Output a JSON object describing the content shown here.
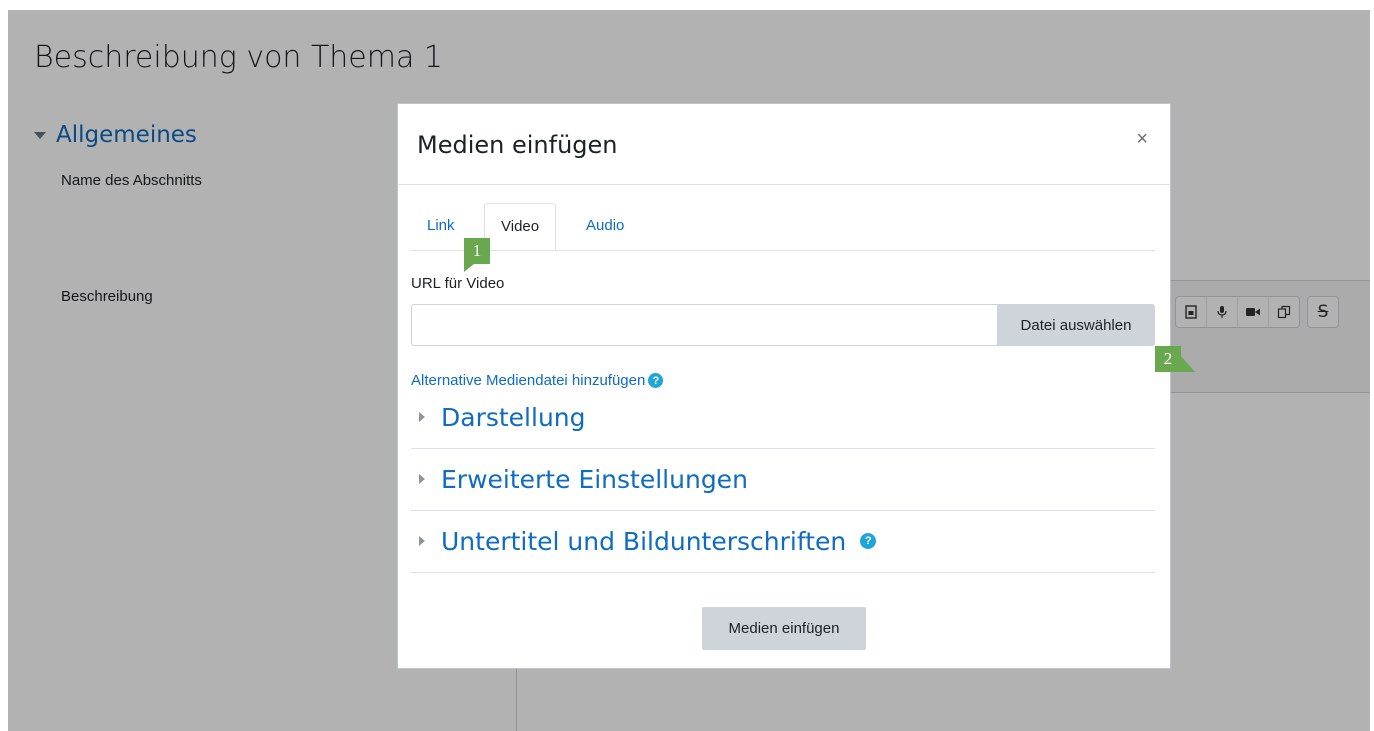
{
  "page": {
    "title": "Beschreibung von Thema 1",
    "section_title": "Allgemeines",
    "name_label": "Name des Abschnitts",
    "description_label": "Beschreibung"
  },
  "editor_toolbar": {
    "icons": [
      "file-media-icon",
      "microphone-icon",
      "video-camera-icon",
      "copy-paste-icon",
      "strikethrough-icon"
    ]
  },
  "modal": {
    "title": "Medien einfügen",
    "close_label": "×",
    "tabs": [
      {
        "label": "Link",
        "active": false
      },
      {
        "label": "Video",
        "active": true
      },
      {
        "label": "Audio",
        "active": false
      }
    ],
    "url_label": "URL für Video",
    "url_value": "",
    "browse_button": "Datei auswählen",
    "alt_media_link": "Alternative Mediendatei hinzufügen",
    "sections": [
      "Darstellung",
      "Erweiterte Einstellungen",
      "Untertitel und Bildunterschriften"
    ],
    "submit_button": "Medien einfügen"
  },
  "annotations": {
    "marker_1": "1",
    "marker_2": "2",
    "color": "#6aa84f"
  },
  "colors": {
    "link": "#0f6cbf",
    "button_bg": "#ced4da",
    "help_icon": "#1fa6d8"
  }
}
